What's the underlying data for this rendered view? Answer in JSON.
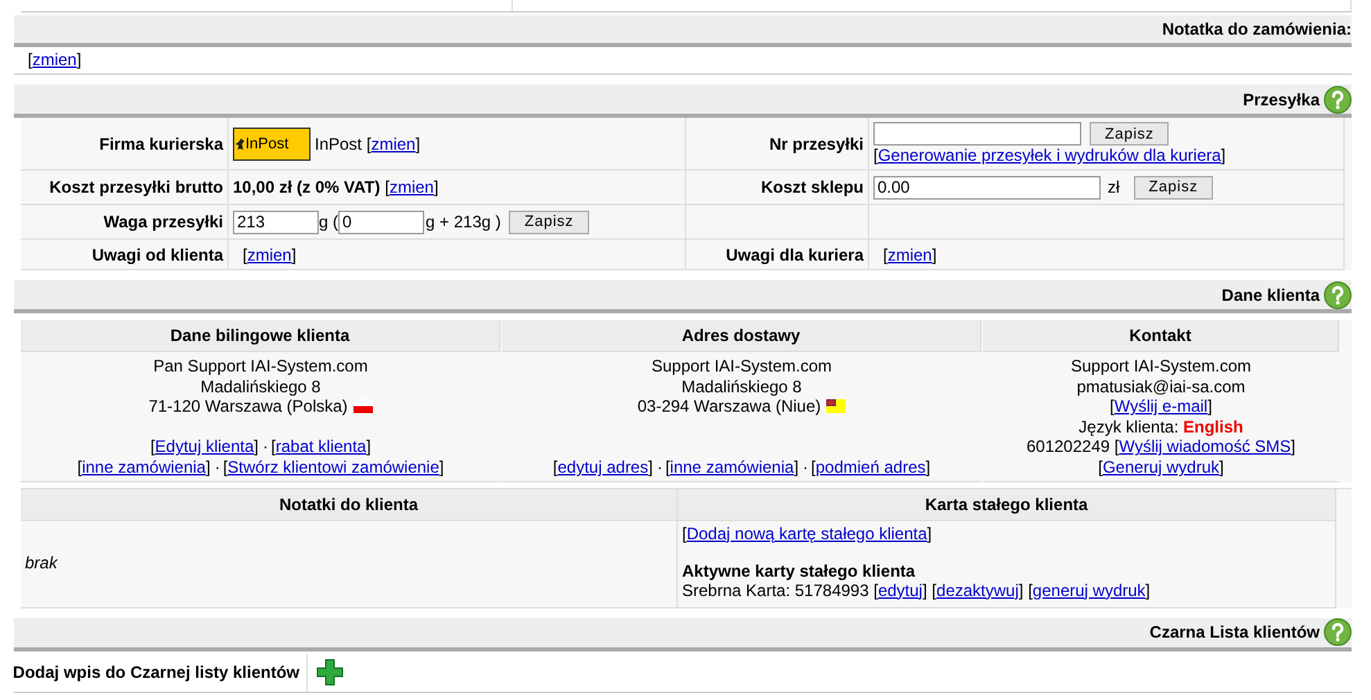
{
  "brackets": [
    "[",
    "]"
  ],
  "separator": "·",
  "order_note": {
    "title": "Notatka do zamówienia:",
    "link": "zmien"
  },
  "shipment": {
    "title": "Przesyłka",
    "courier": {
      "label": "Firma kurierska",
      "logo_text": "InPost",
      "name": "InPost",
      "link": "zmien"
    },
    "cost": {
      "label": "Koszt przesyłki brutto",
      "value": "10,00 zł (z 0% VAT)",
      "link": "zmien"
    },
    "weight": {
      "label": "Waga przesyłki",
      "value": "213",
      "unit": "g (",
      "extra": "0",
      "suffix": "g + 213g )",
      "button": "Zapisz"
    },
    "customer_notes": {
      "label": "Uwagi od klienta",
      "link": "zmien"
    },
    "tracking": {
      "label": "Nr przesyłki",
      "button": "Zapisz",
      "link": "Generowanie przesyłek i wydruków dla kuriera"
    },
    "shop_cost": {
      "label": "Koszt sklepu",
      "value": "0.00",
      "unit": "zł",
      "button": "Zapisz"
    },
    "courier_notes": {
      "label": "Uwagi dla kuriera",
      "link": "zmien"
    }
  },
  "client": {
    "title": "Dane klienta",
    "billing": {
      "heading": "Dane bilingowe klienta",
      "lines": [
        "Pan Support IAI-System.com",
        "Madalińskiego 8",
        "71-120 Warszawa (Polska)"
      ],
      "link_rows": [
        [
          "Edytuj klienta",
          "rabat klienta"
        ],
        [
          "inne zamówienia",
          "Stwórz klientowi zamówienie"
        ]
      ]
    },
    "delivery": {
      "heading": "Adres dostawy",
      "lines": [
        "Support IAI-System.com",
        "Madalińskiego 8",
        "03-294 Warszawa (Niue)"
      ],
      "link_rows": [
        [
          "edytuj adres",
          "inne zamówienia",
          "podmień adres"
        ]
      ]
    },
    "contact": {
      "heading": "Kontakt",
      "name": "Support IAI-System.com",
      "email": "pmatusiak@iai-sa.com",
      "email_link": "Wyślij e-mail",
      "language_label": "Język klienta:",
      "language": "English",
      "phone": "601202249",
      "sms_link": "Wyślij wiadomość SMS",
      "print_link": "Generuj wydruk"
    }
  },
  "notes": {
    "heading": "Notatki do klienta",
    "text": "brak"
  },
  "loyalty": {
    "heading": "Karta stałego klienta",
    "add_link": "Dodaj nową kartę stałego klienta",
    "active_title": "Aktywne karty stałego klienta",
    "card": "Srebrna Karta: 51784993",
    "links": [
      "edytuj",
      "dezaktywuj",
      "generuj wydruk"
    ]
  },
  "blacklist": {
    "title": "Czarna Lista klientów",
    "label": "Dodaj wpis do Czarnej listy klientów"
  }
}
